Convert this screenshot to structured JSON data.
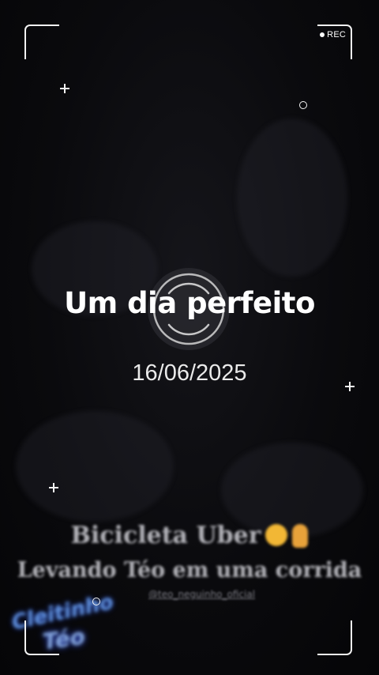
{
  "overlay": {
    "recording_label": "REC",
    "title": "Um dia perfeito",
    "date": "16/06/2025"
  },
  "background_video": {
    "caption_line1": "Bicicleta Uber",
    "caption_line2": "Levando Téo em uma corrida",
    "handle": "@teo_neguinho_oficial"
  },
  "icons": {
    "recording": "record-dot-icon",
    "focus": "focus-reticle-icon",
    "sparkle": "plus-sparkle-icon",
    "bubble": "circle-sparkle-icon",
    "laughing_emoji": "laughing-emoji-icon",
    "pointing_emoji": "pointing-down-emoji-icon"
  },
  "colors": {
    "frame": "#f2f2f2",
    "title": "#ffffff",
    "date": "#eaeaea",
    "background": "#07070a"
  }
}
